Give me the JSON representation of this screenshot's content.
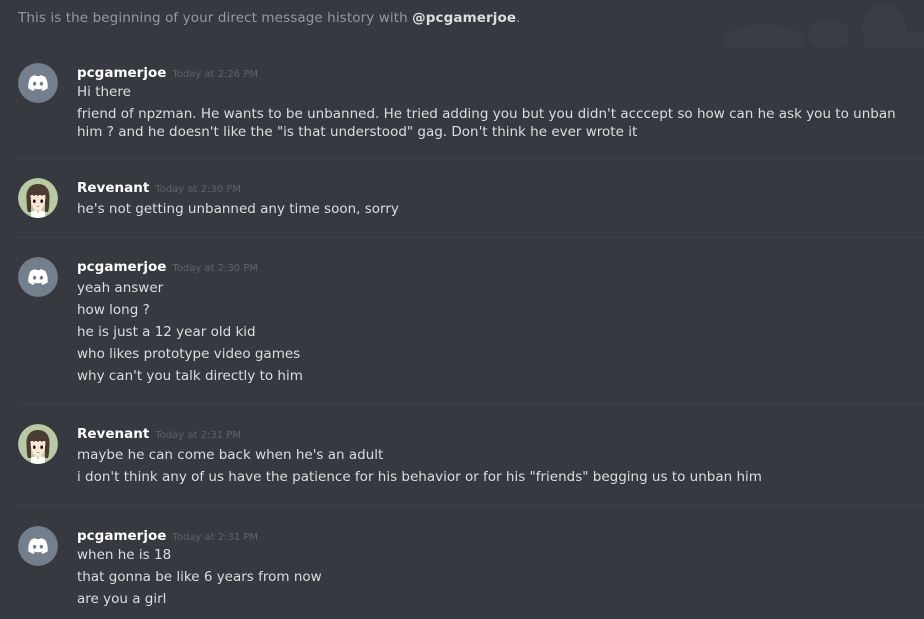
{
  "intro": {
    "prefix": "This is the beginning of your direct message history with ",
    "handle": "@pcgamerjoe",
    "suffix": "."
  },
  "colors": {
    "background": "#36393f",
    "text": "#dcddde",
    "muted": "#96989d",
    "timestamp": "#5f6269",
    "discord_avatar": "#747f8d",
    "divider": "#3f4248"
  },
  "messages": [
    {
      "author": "pcgamerjoe",
      "avatar": "discord-logo-icon",
      "timestamp": "Today at 2:26 PM",
      "lines": [
        "Hi there",
        "friend of npzman. He wants to be unbanned. He tried adding you but you didn't acccept so how can he ask you to unban him ? and he doesn't like the \"is that understood\" gag. Don't think he ever wrote it"
      ]
    },
    {
      "author": "Revenant",
      "avatar": "anime-girl-avatar",
      "timestamp": "Today at 2:30 PM",
      "lines": [
        "he's not getting unbanned any time soon, sorry"
      ]
    },
    {
      "author": "pcgamerjoe",
      "avatar": "discord-logo-icon",
      "timestamp": "Today at 2:30 PM",
      "lines": [
        "yeah answer",
        "how long ?",
        "he is just a 12 year old kid",
        "who likes prototype video games",
        "why can't you talk directly to him"
      ]
    },
    {
      "author": "Revenant",
      "avatar": "anime-girl-avatar",
      "timestamp": "Today at 2:31 PM",
      "lines": [
        "maybe he can come back when he's an adult",
        "i don't think any of us have the patience for his behavior or for his \"friends\" begging us to unban him"
      ]
    },
    {
      "author": "pcgamerjoe",
      "avatar": "discord-logo-icon",
      "timestamp": "Today at 2:31 PM",
      "lines": [
        "when he is 18",
        "that gonna be like 6 years from now",
        "are you a girl"
      ]
    }
  ]
}
